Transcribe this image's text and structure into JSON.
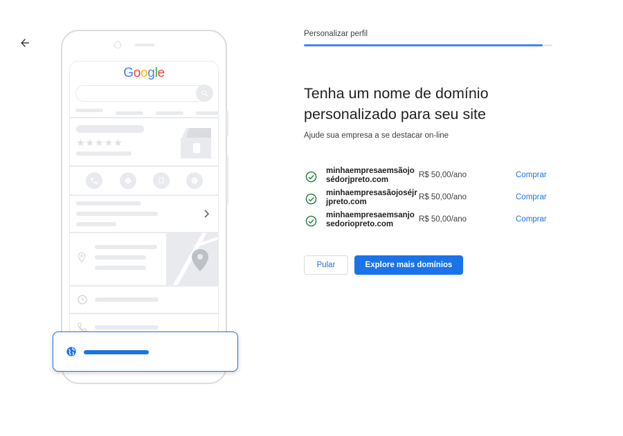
{
  "nav": {
    "back_icon": "arrow-left-icon"
  },
  "progress": {
    "step_label": "Personalizar perfil",
    "value_fraction": 0.96
  },
  "heading": "Tenha um nome de domínio personalizado para seu site",
  "subtitle": "Ajude sua empresa a se destacar on-line",
  "domains": [
    {
      "name": "minhaempresaemsãojosédorjpreto.com",
      "price": "R$ 50,00/ano",
      "action": "Comprar"
    },
    {
      "name": "minhaempresasãojoséjrjpreto.com",
      "price": "R$ 50,00/ano",
      "action": "Comprar"
    },
    {
      "name": "minhaempresaemsanjosedoriopreto.com",
      "price": "R$ 50,00/ano",
      "action": "Comprar"
    }
  ],
  "buttons": {
    "skip": "Pular",
    "explore": "Explore mais domínios"
  },
  "illustration": {
    "logo_letters": [
      "G",
      "o",
      "o",
      "g",
      "l",
      "e"
    ],
    "logo_colors": [
      "#4285f4",
      "#ea4335",
      "#fbbc05",
      "#4285f4",
      "#34a853",
      "#ea4335"
    ],
    "stars": "★★★★★"
  },
  "colors": {
    "accent": "#1a73e8",
    "success": "#188038",
    "progress": "#4285f4"
  }
}
